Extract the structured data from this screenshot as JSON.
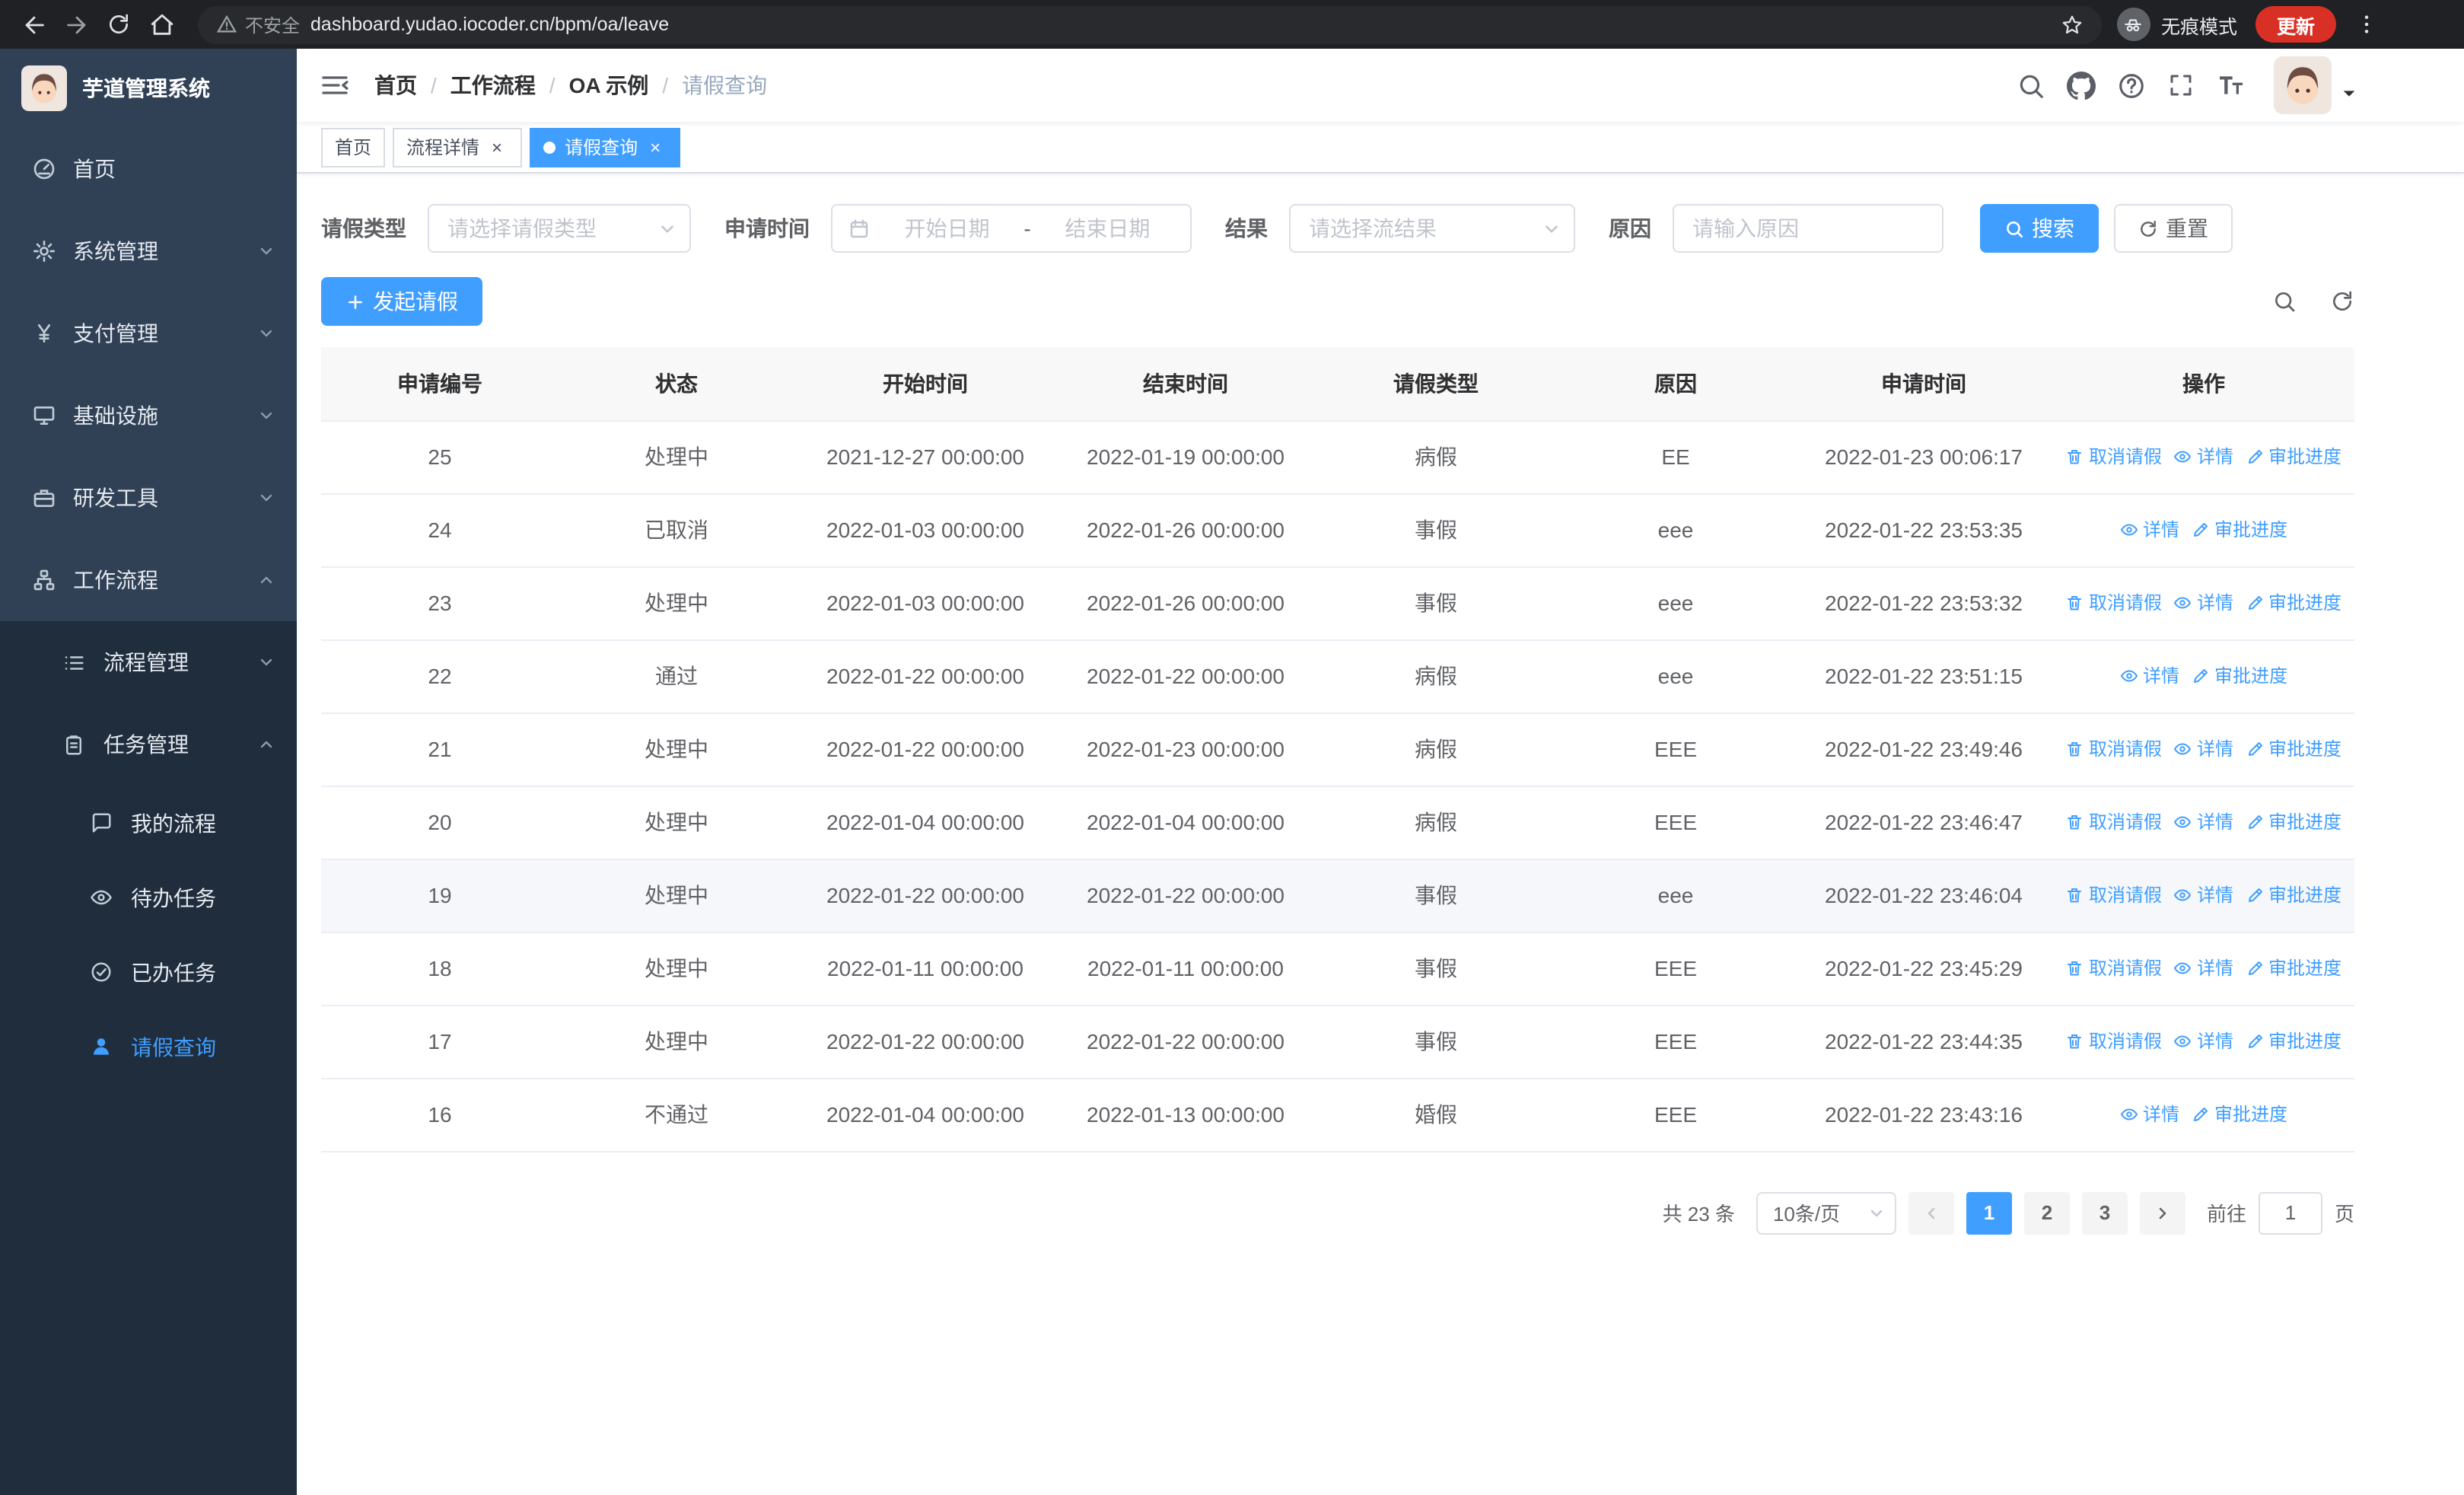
{
  "browser": {
    "security_label": "不安全",
    "url": "dashboard.yudao.iocoder.cn/bpm/oa/leave",
    "incognito_label": "无痕模式",
    "update_label": "更新"
  },
  "sidebar": {
    "title": "芋道管理系统",
    "top_items": [
      {
        "label": "首页",
        "icon": "dashboard-icon",
        "state": "none"
      },
      {
        "label": "系统管理",
        "icon": "gear-icon",
        "state": "collapsed"
      },
      {
        "label": "支付管理",
        "icon": "yen-icon",
        "state": "collapsed"
      },
      {
        "label": "基础设施",
        "icon": "monitor-icon",
        "state": "collapsed"
      },
      {
        "label": "研发工具",
        "icon": "briefcase-icon",
        "state": "collapsed"
      },
      {
        "label": "工作流程",
        "icon": "workflow-icon",
        "state": "expanded"
      }
    ],
    "workflow_children": [
      {
        "label": "流程管理",
        "icon": "list-icon",
        "state": "collapsed"
      },
      {
        "label": "任务管理",
        "icon": "clipboard-icon",
        "state": "expanded"
      }
    ],
    "task_children": [
      {
        "label": "我的流程",
        "icon": "chat-icon",
        "active": false
      },
      {
        "label": "待办任务",
        "icon": "eye-icon",
        "active": false
      },
      {
        "label": "已办任务",
        "icon": "check-circle-icon",
        "active": false
      },
      {
        "label": "请假查询",
        "icon": "user-icon",
        "active": true
      }
    ]
  },
  "breadcrumb": [
    "首页",
    "工作流程",
    "OA 示例",
    "请假查询"
  ],
  "tabs": [
    {
      "label": "首页",
      "active": false,
      "closable": false
    },
    {
      "label": "流程详情",
      "active": false,
      "closable": true
    },
    {
      "label": "请假查询",
      "active": true,
      "closable": true
    }
  ],
  "filters": {
    "leave_type_label": "请假类型",
    "leave_type_placeholder": "请选择请假类型",
    "apply_time_label": "申请时间",
    "start_date_placeholder": "开始日期",
    "range_separator": "-",
    "end_date_placeholder": "结束日期",
    "result_label": "结果",
    "result_placeholder": "请选择流结果",
    "reason_label": "原因",
    "reason_placeholder": "请输入原因",
    "search_button": "搜索",
    "reset_button": "重置"
  },
  "toolbar": {
    "create_button": "发起请假"
  },
  "table": {
    "columns": [
      "申请编号",
      "状态",
      "开始时间",
      "结束时间",
      "请假类型",
      "原因",
      "申请时间",
      "操作"
    ],
    "actions": {
      "cancel": "取消请假",
      "detail": "详情",
      "progress": "审批进度"
    },
    "rows": [
      {
        "id": "25",
        "status": "处理中",
        "start": "2021-12-27 00:00:00",
        "end": "2022-01-19 00:00:00",
        "type": "病假",
        "reason": "EE",
        "applied": "2022-01-23 00:06:17",
        "actions": [
          "cancel",
          "detail",
          "progress"
        ],
        "hover": false
      },
      {
        "id": "24",
        "status": "已取消",
        "start": "2022-01-03 00:00:00",
        "end": "2022-01-26 00:00:00",
        "type": "事假",
        "reason": "eee",
        "applied": "2022-01-22 23:53:35",
        "actions": [
          "detail",
          "progress"
        ],
        "hover": false
      },
      {
        "id": "23",
        "status": "处理中",
        "start": "2022-01-03 00:00:00",
        "end": "2022-01-26 00:00:00",
        "type": "事假",
        "reason": "eee",
        "applied": "2022-01-22 23:53:32",
        "actions": [
          "cancel",
          "detail",
          "progress"
        ],
        "hover": false
      },
      {
        "id": "22",
        "status": "通过",
        "start": "2022-01-22 00:00:00",
        "end": "2022-01-22 00:00:00",
        "type": "病假",
        "reason": "eee",
        "applied": "2022-01-22 23:51:15",
        "actions": [
          "detail",
          "progress"
        ],
        "hover": false
      },
      {
        "id": "21",
        "status": "处理中",
        "start": "2022-01-22 00:00:00",
        "end": "2022-01-23 00:00:00",
        "type": "病假",
        "reason": "EEE",
        "applied": "2022-01-22 23:49:46",
        "actions": [
          "cancel",
          "detail",
          "progress"
        ],
        "hover": false
      },
      {
        "id": "20",
        "status": "处理中",
        "start": "2022-01-04 00:00:00",
        "end": "2022-01-04 00:00:00",
        "type": "病假",
        "reason": "EEE",
        "applied": "2022-01-22 23:46:47",
        "actions": [
          "cancel",
          "detail",
          "progress"
        ],
        "hover": false
      },
      {
        "id": "19",
        "status": "处理中",
        "start": "2022-01-22 00:00:00",
        "end": "2022-01-22 00:00:00",
        "type": "事假",
        "reason": "eee",
        "applied": "2022-01-22 23:46:04",
        "actions": [
          "cancel",
          "detail",
          "progress"
        ],
        "hover": true
      },
      {
        "id": "18",
        "status": "处理中",
        "start": "2022-01-11 00:00:00",
        "end": "2022-01-11 00:00:00",
        "type": "事假",
        "reason": "EEE",
        "applied": "2022-01-22 23:45:29",
        "actions": [
          "cancel",
          "detail",
          "progress"
        ],
        "hover": false
      },
      {
        "id": "17",
        "status": "处理中",
        "start": "2022-01-22 00:00:00",
        "end": "2022-01-22 00:00:00",
        "type": "事假",
        "reason": "EEE",
        "applied": "2022-01-22 23:44:35",
        "actions": [
          "cancel",
          "detail",
          "progress"
        ],
        "hover": false
      },
      {
        "id": "16",
        "status": "不通过",
        "start": "2022-01-04 00:00:00",
        "end": "2022-01-13 00:00:00",
        "type": "婚假",
        "reason": "EEE",
        "applied": "2022-01-22 23:43:16",
        "actions": [
          "detail",
          "progress"
        ],
        "hover": false
      }
    ]
  },
  "pagination": {
    "total": "共 23 条",
    "page_size": "10条/页",
    "pages": [
      "1",
      "2",
      "3"
    ],
    "active_page": "1",
    "goto_label": "前往",
    "goto_value": "1",
    "page_label": "页"
  },
  "colors": {
    "accent": "#409eff",
    "sidebar_bg": "#304156",
    "submenu_bg": "#1f2d3d",
    "table_header_bg": "#f8f8f9",
    "row_hover_bg": "#f5f7fa",
    "update_button_red": "#d93025",
    "browser_bar_bg": "#202124"
  },
  "icons": {
    "back": "←",
    "forward": "→",
    "reload": "⟳",
    "home": "⌂",
    "warning": "⚠",
    "star": "☆",
    "incognito": "spy-glasses",
    "menu-dots": "⋮",
    "hamburger": "☰",
    "search": "magnifier",
    "github": "octocat",
    "help": "?",
    "fullscreen": "corner-brackets",
    "font-size": "Tt",
    "caret-down": "▾",
    "chevron": "v",
    "calendar": "grid-box",
    "plus": "+",
    "refresh": "circular-arrow",
    "delete": "trash-can",
    "view": "eye",
    "edit": "pen",
    "yen": "¥",
    "user": "person-silhouette"
  }
}
